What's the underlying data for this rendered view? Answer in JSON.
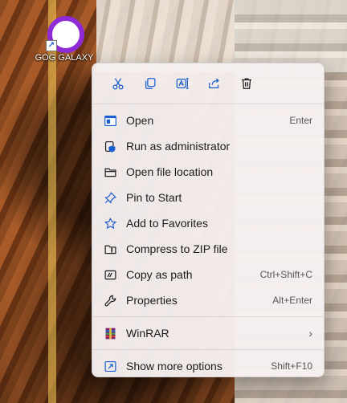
{
  "desktop": {
    "icon_label": "GOG GALAXY"
  },
  "colors": {
    "accent": "#1a5fd0",
    "gog_purple": "#8e2bd6",
    "menu_bg": "#f6f0f0"
  },
  "context_menu": {
    "quick_actions": [
      {
        "name": "cut-icon"
      },
      {
        "name": "copy-icon"
      },
      {
        "name": "rename-icon"
      },
      {
        "name": "share-icon"
      },
      {
        "name": "delete-icon"
      }
    ],
    "items": [
      {
        "label": "Open",
        "shortcut": "Enter",
        "icon": "open-window-icon"
      },
      {
        "label": "Run as administrator",
        "shortcut": "",
        "icon": "shield-icon"
      },
      {
        "label": "Open file location",
        "shortcut": "",
        "icon": "folder-icon"
      },
      {
        "label": "Pin to Start",
        "shortcut": "",
        "icon": "pin-icon"
      },
      {
        "label": "Add to Favorites",
        "shortcut": "",
        "icon": "star-icon"
      },
      {
        "label": "Compress to ZIP file",
        "shortcut": "",
        "icon": "zip-folder-icon"
      },
      {
        "label": "Copy as path",
        "shortcut": "Ctrl+Shift+C",
        "icon": "copy-path-icon"
      },
      {
        "label": "Properties",
        "shortcut": "Alt+Enter",
        "icon": "wrench-icon"
      }
    ],
    "winrar": {
      "label": "WinRAR",
      "icon": "winrar-icon"
    },
    "more": {
      "label": "Show more options",
      "shortcut": "Shift+F10",
      "icon": "more-options-icon"
    }
  }
}
